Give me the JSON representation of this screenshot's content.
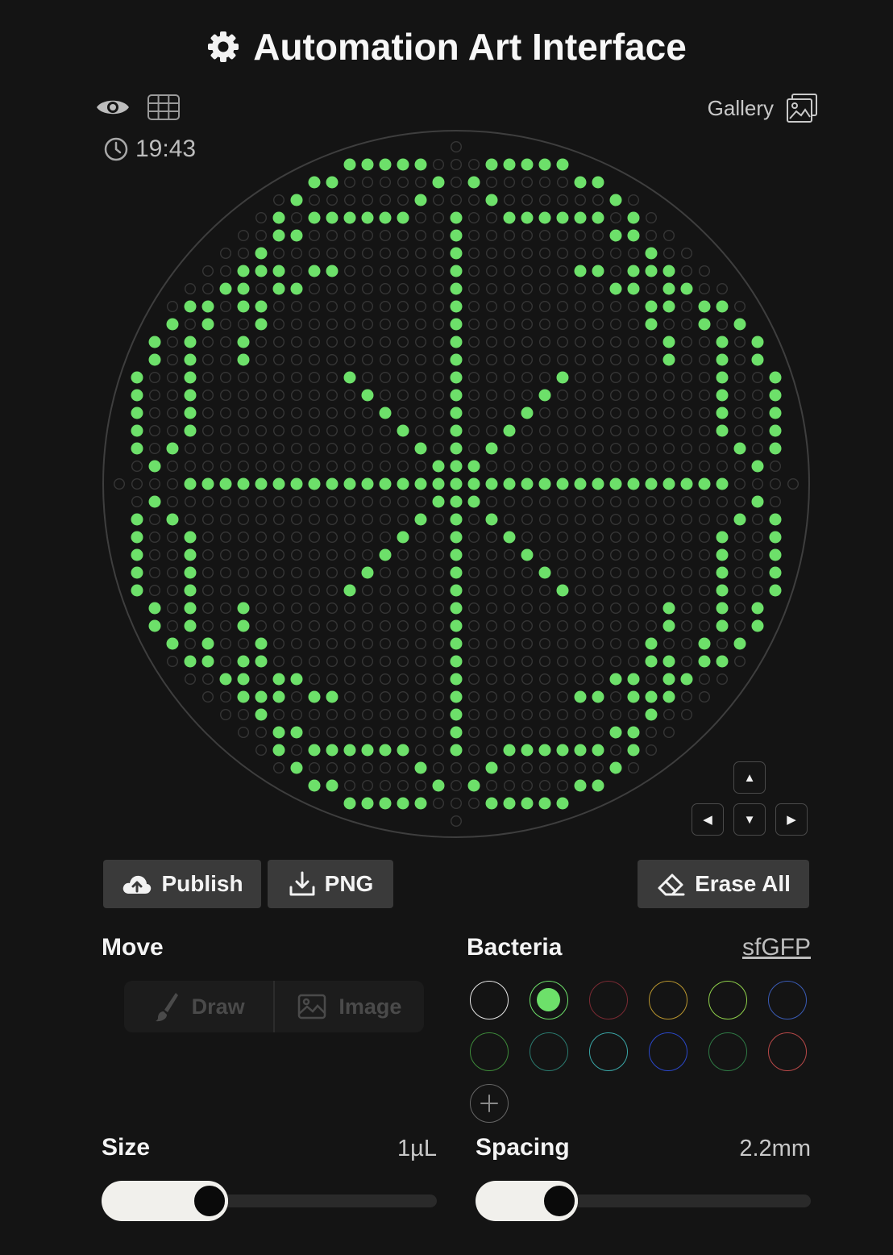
{
  "app": {
    "title": "Automation Art Interface",
    "title_icon": "gear-icon"
  },
  "toolbar": {
    "visibility_icon": "eye-icon",
    "grid_icon": "grid-icon",
    "time": "19:43",
    "gallery_label": "Gallery",
    "gallery_icon": "gallery-icon"
  },
  "plate": {
    "grid_rows": 37,
    "grid_cols": 37,
    "colors": {
      "filled": "#6de06a",
      "empty_well": "#363636",
      "dish_edge": "#3e3e3e"
    },
    "pattern_rows": [
      ".........................................",
      ".........................................",
      ".........................................",
      ".........................................",
      ".........................................",
      "........................................."
    ]
  },
  "nudge": {
    "up": "▲",
    "left": "◀",
    "down": "▼",
    "right": "▶"
  },
  "actions": {
    "publish_label": "Publish",
    "publish_icon": "cloud-upload-icon",
    "png_label": "PNG",
    "png_icon": "download-icon",
    "erase_label": "Erase All",
    "erase_icon": "eraser-icon"
  },
  "move": {
    "label": "Move",
    "modes": [
      {
        "label": "Draw",
        "icon": "brush-icon"
      },
      {
        "label": "Image",
        "icon": "image-icon"
      }
    ]
  },
  "bacteria": {
    "label": "Bacteria",
    "selected_strain": "sfGFP",
    "swatches": [
      {
        "color": "#e6e6e6",
        "selected": false
      },
      {
        "color": "#6de06a",
        "selected": true
      },
      {
        "color": "#7a2a33",
        "selected": false
      },
      {
        "color": "#b8952e",
        "selected": false
      },
      {
        "color": "#8fd04a",
        "selected": false
      },
      {
        "color": "#3a5bb5",
        "selected": false
      },
      {
        "color": "#3d8a3a",
        "selected": false
      },
      {
        "color": "#2b7a6e",
        "selected": false
      },
      {
        "color": "#3aa6a6",
        "selected": false
      },
      {
        "color": "#2a47c8",
        "selected": false
      },
      {
        "color": "#2f7a45",
        "selected": false
      },
      {
        "color": "#b84848",
        "selected": false
      }
    ],
    "add_icon": "plus-icon"
  },
  "size": {
    "label": "Size",
    "value": "1µL",
    "fraction": 0.3
  },
  "spacing": {
    "label": "Spacing",
    "value": "2.2mm",
    "fraction": 0.22
  }
}
